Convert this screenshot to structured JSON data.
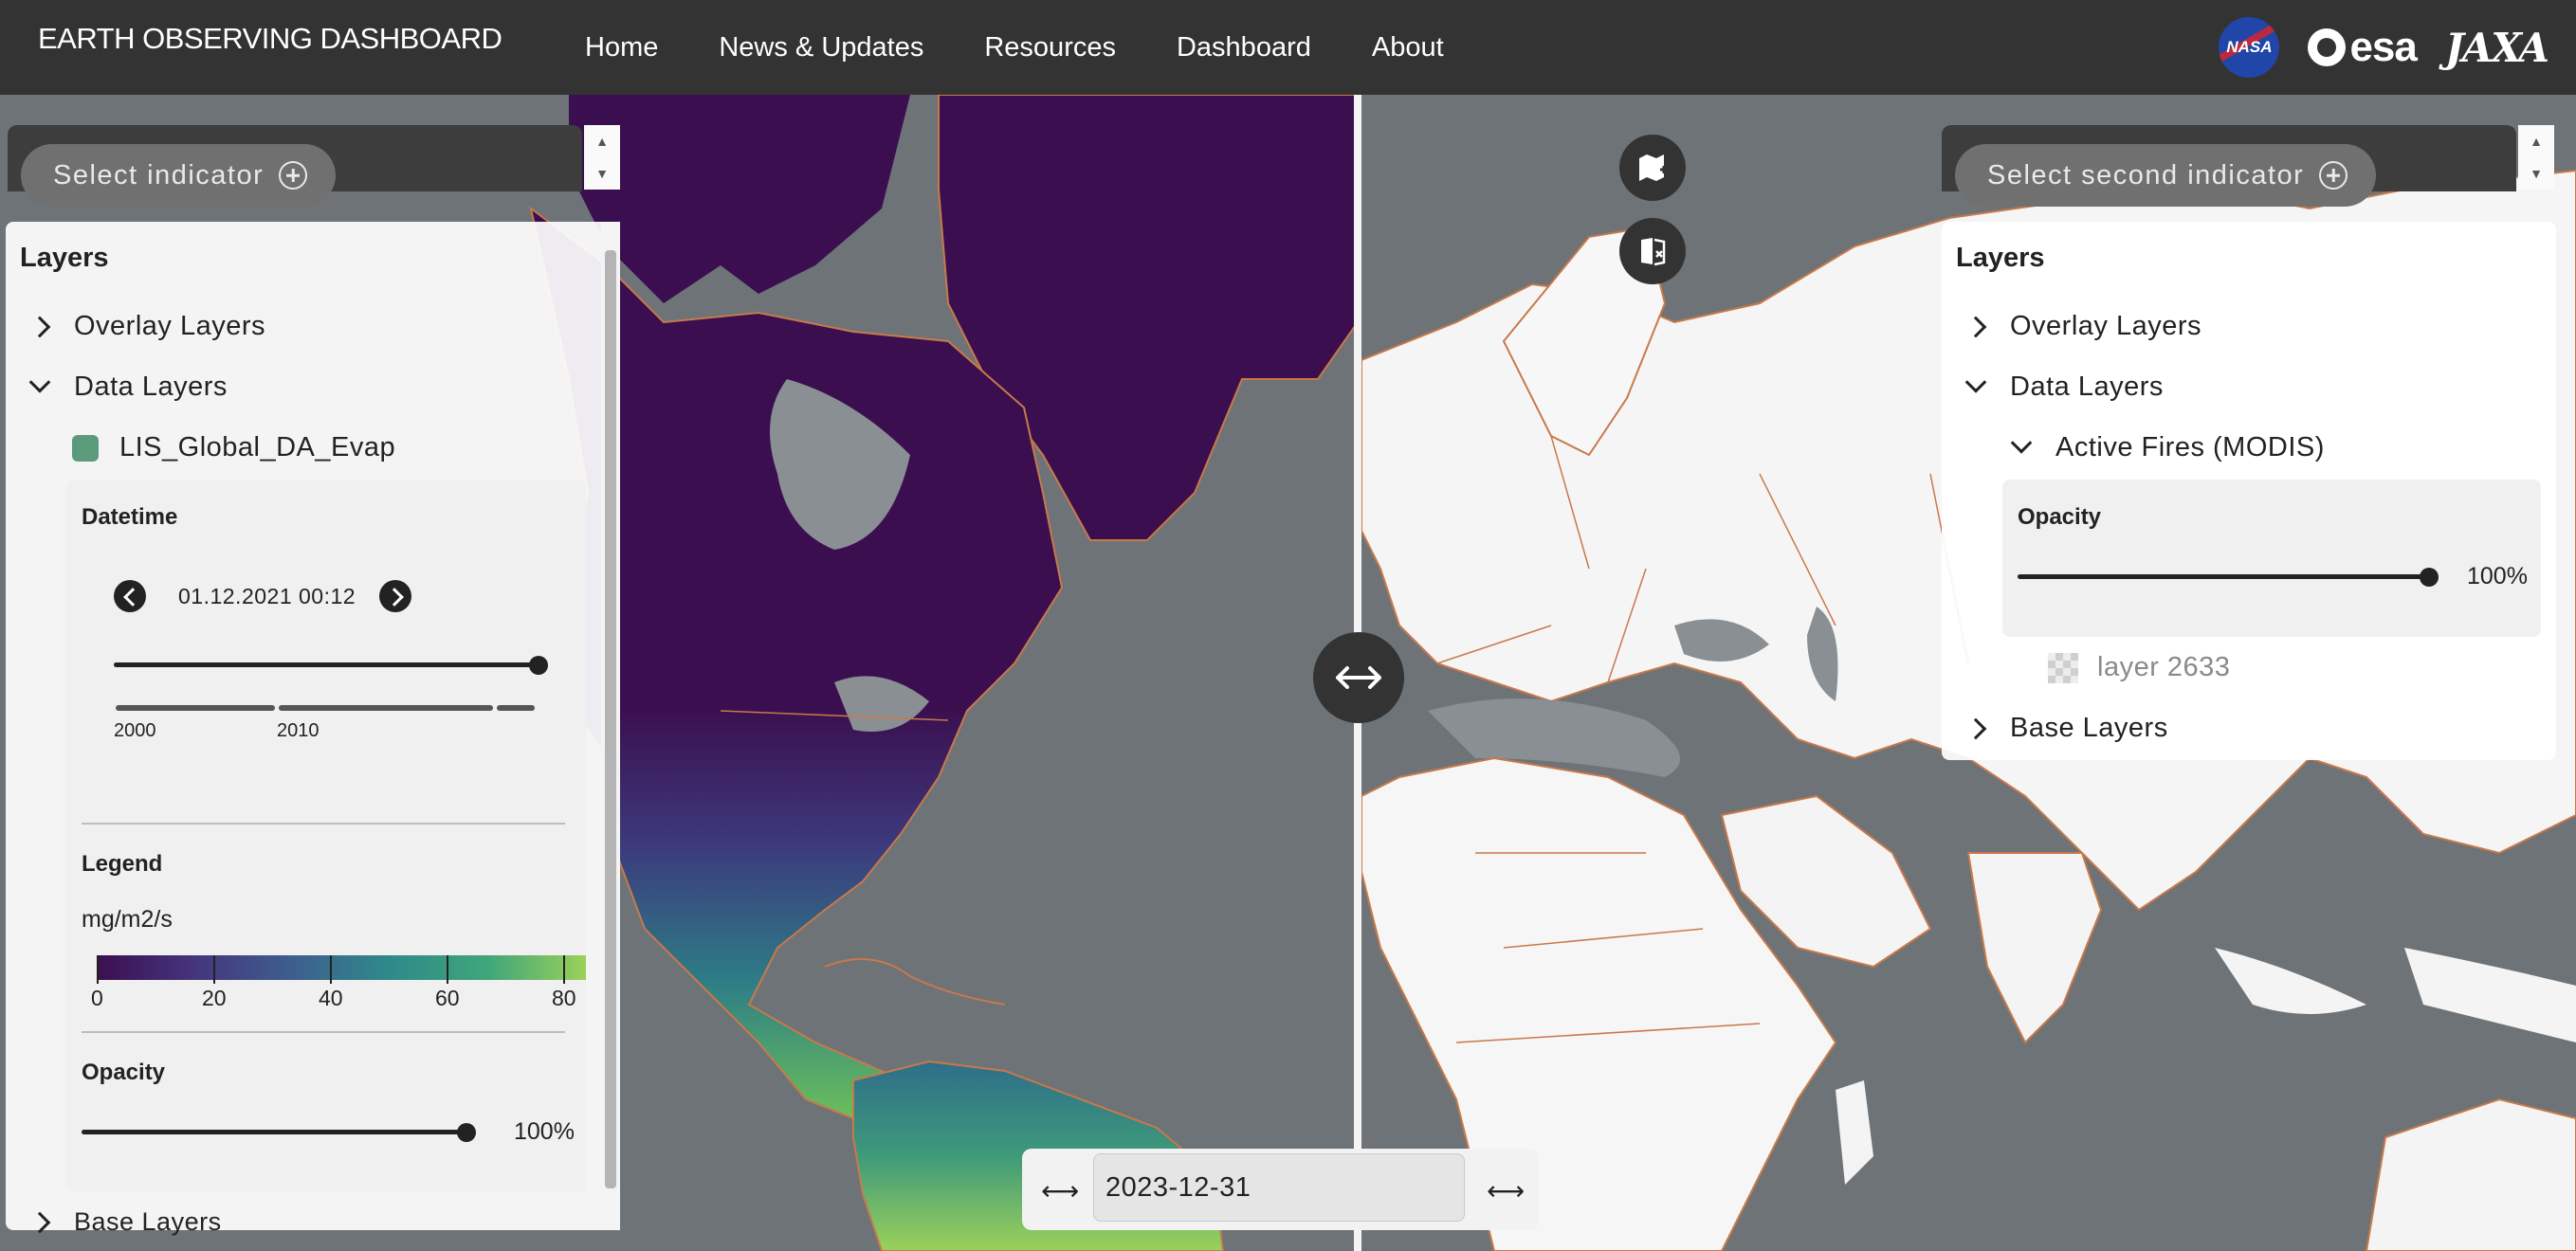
{
  "header": {
    "title": "EARTH OBSERVING DASHBOARD",
    "nav": [
      "Home",
      "News & Updates",
      "Resources",
      "Dashboard",
      "About"
    ],
    "logos": {
      "nasa": "NASA",
      "esa": "esa",
      "jaxa": "JAXA"
    }
  },
  "left": {
    "select_indicator": "Select indicator",
    "layers_title": "Layers",
    "overlay_layers": "Overlay Layers",
    "data_layers": "Data Layers",
    "layer_name": "LIS_Global_DA_Evap",
    "datetime_label": "Datetime",
    "datetime_value": "01.12.2021 00:12",
    "timeline_ticks": [
      "2000",
      "2010"
    ],
    "legend_label": "Legend",
    "legend_unit": "mg/m2/s",
    "legend_ticks": [
      "0",
      "20",
      "40",
      "60",
      "80"
    ],
    "opacity_label": "Opacity",
    "opacity_value": "100%",
    "base_layers": "Base Layers"
  },
  "right": {
    "select_indicator": "Select second indicator",
    "layers_title": "Layers",
    "overlay_layers": "Overlay Layers",
    "data_layers": "Data Layers",
    "active_layer": "Active Fires (MODIS)",
    "opacity_label": "Opacity",
    "opacity_value": "100%",
    "sublayer": "layer 2633",
    "base_layers": "Base Layers"
  },
  "datepicker": {
    "value": "2023-12-31",
    "prev_symbol": "⟷",
    "next_symbol": "⟷"
  },
  "colors": {
    "topbar": "#333333",
    "evap_low": "#3b0f4f",
    "evap_high": "#9bd15a",
    "land": "#f6f6f6",
    "borders": "#c8794a",
    "ocean": "#6f7479"
  }
}
